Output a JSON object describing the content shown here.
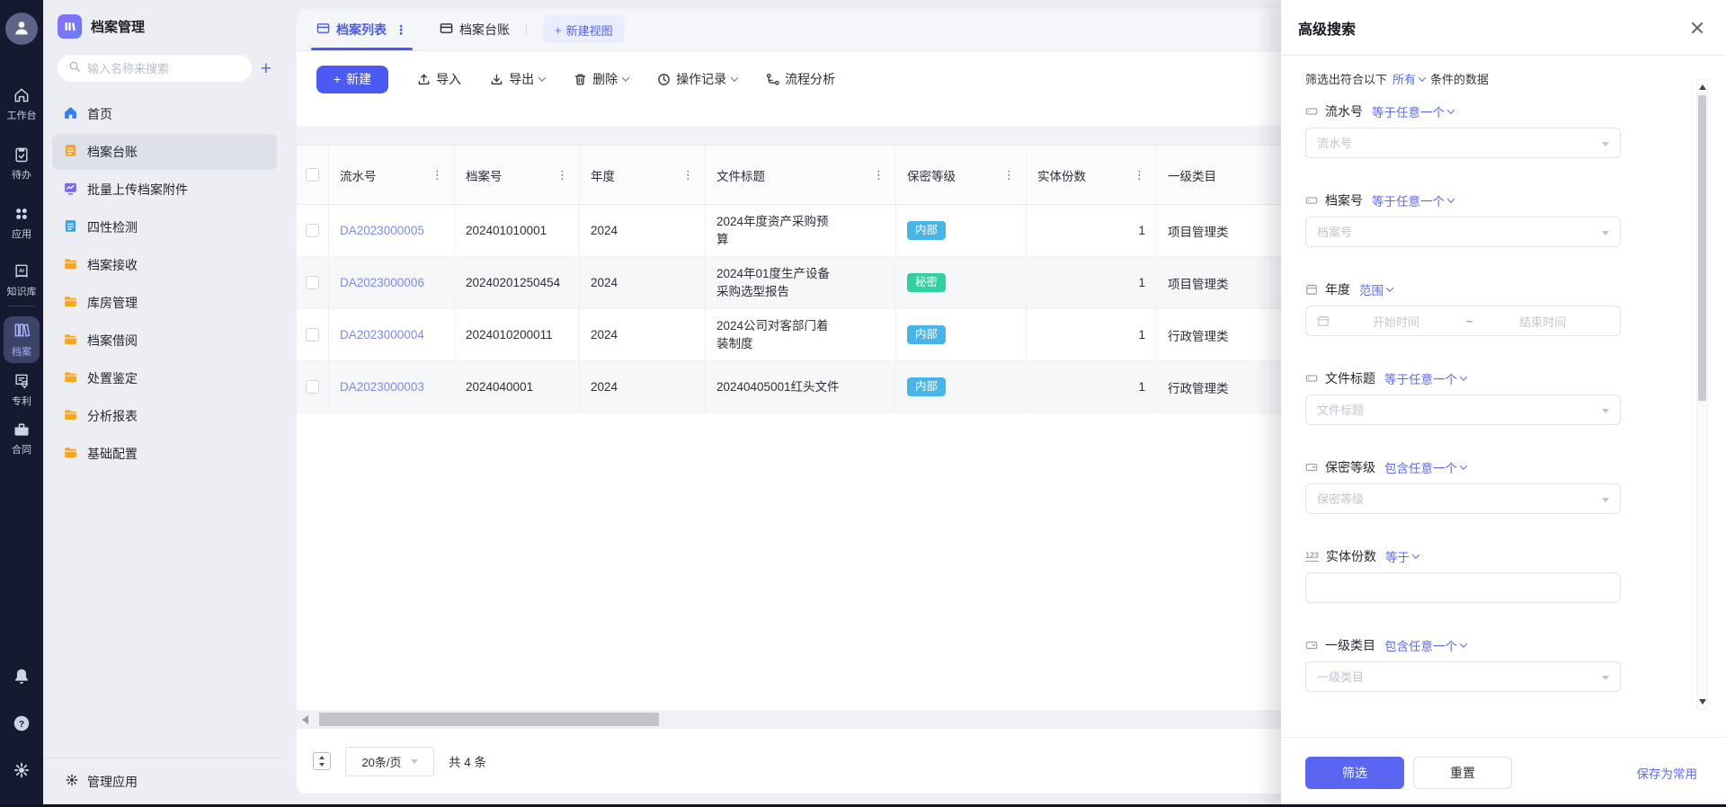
{
  "colors": {
    "accent_blue": "#4a5af2",
    "panel_link_blue": "#5b68f4",
    "row_link": "#7e89f3",
    "badge_internal": "#48b5e9",
    "badge_secret": "#30d1a1",
    "rail_bg": "#151a30",
    "sidebar_bg": "#eceef3"
  },
  "icons": {
    "dots": "⋮",
    "plus": "+",
    "question": "?",
    "num123": "123"
  },
  "rail": {
    "items": [
      {
        "label": "工作台"
      },
      {
        "label": "待办"
      },
      {
        "label": "应用"
      },
      {
        "label": "知识库"
      },
      {
        "label": "档案"
      },
      {
        "label": "专利"
      },
      {
        "label": "合同"
      }
    ]
  },
  "sidebar": {
    "app_title": "档案管理",
    "search_placeholder": "输入名称来搜索",
    "items": [
      {
        "label": "首页"
      },
      {
        "label": "档案台账"
      },
      {
        "label": "批量上传档案附件"
      },
      {
        "label": "四性检测"
      },
      {
        "label": "档案接收"
      },
      {
        "label": "库房管理"
      },
      {
        "label": "档案借阅"
      },
      {
        "label": "处置鉴定"
      },
      {
        "label": "分析报表"
      },
      {
        "label": "基础配置"
      }
    ],
    "footer_label": "管理应用"
  },
  "tabs": {
    "archive_list": "档案列表",
    "archive_ledger": "档案台账",
    "new_view": "新建视图"
  },
  "toolbar": {
    "create": "新建",
    "import": "导入",
    "export": "导出",
    "delete": "删除",
    "logs": "操作记录",
    "flow": "流程分析"
  },
  "table": {
    "columns": [
      "流水号",
      "档案号",
      "年度",
      "文件标题",
      "保密等级",
      "实体份数",
      "一级类目"
    ],
    "rows": [
      {
        "serial": "DA2023000005",
        "archive_no": "202401010001",
        "year": "2024",
        "title": "2024年度资产采购预算",
        "level": "内部",
        "level_type": "internal",
        "copies": "1",
        "category": "项目管理类"
      },
      {
        "serial": "DA2023000006",
        "archive_no": "20240201250454",
        "year": "2024",
        "title": "2024年01度生产设备采购选型报告",
        "level": "秘密",
        "level_type": "secret",
        "copies": "1",
        "category": "项目管理类"
      },
      {
        "serial": "DA2023000004",
        "archive_no": "2024010200011",
        "year": "2024",
        "title": "2024公司对客部门着装制度",
        "level": "内部",
        "level_type": "internal",
        "copies": "1",
        "category": "行政管理类"
      },
      {
        "serial": "DA2023000003",
        "archive_no": "2024040001",
        "year": "2024",
        "title": "20240405001红头文件",
        "level": "内部",
        "level_type": "internal",
        "copies": "1",
        "category": "行政管理类"
      }
    ]
  },
  "pagination": {
    "page_size": "20条/页",
    "total": "共 4 条"
  },
  "panel": {
    "title": "高级搜索",
    "intro_prefix": "筛选出符合以下",
    "intro_match": "所有",
    "intro_suffix": "条件的数据",
    "fields": [
      {
        "label": "流水号",
        "condition": "等于任意一个",
        "placeholder": "流水号"
      },
      {
        "label": "档案号",
        "condition": "等于任意一个",
        "placeholder": "档案号"
      },
      {
        "label": "年度",
        "condition": "范围",
        "start": "开始时间",
        "tilde": "~",
        "end": "结束时间"
      },
      {
        "label": "文件标题",
        "condition": "等于任意一个",
        "placeholder": "文件标题"
      },
      {
        "label": "保密等级",
        "condition": "包含任意一个",
        "placeholder": "保密等级"
      },
      {
        "label": "实体份数",
        "condition": "等于",
        "placeholder": ""
      },
      {
        "label": "一级类目",
        "condition": "包含任意一个",
        "placeholder": "一级类目"
      }
    ],
    "footer": {
      "filter": "筛选",
      "reset": "重置",
      "save": "保存为常用"
    }
  }
}
